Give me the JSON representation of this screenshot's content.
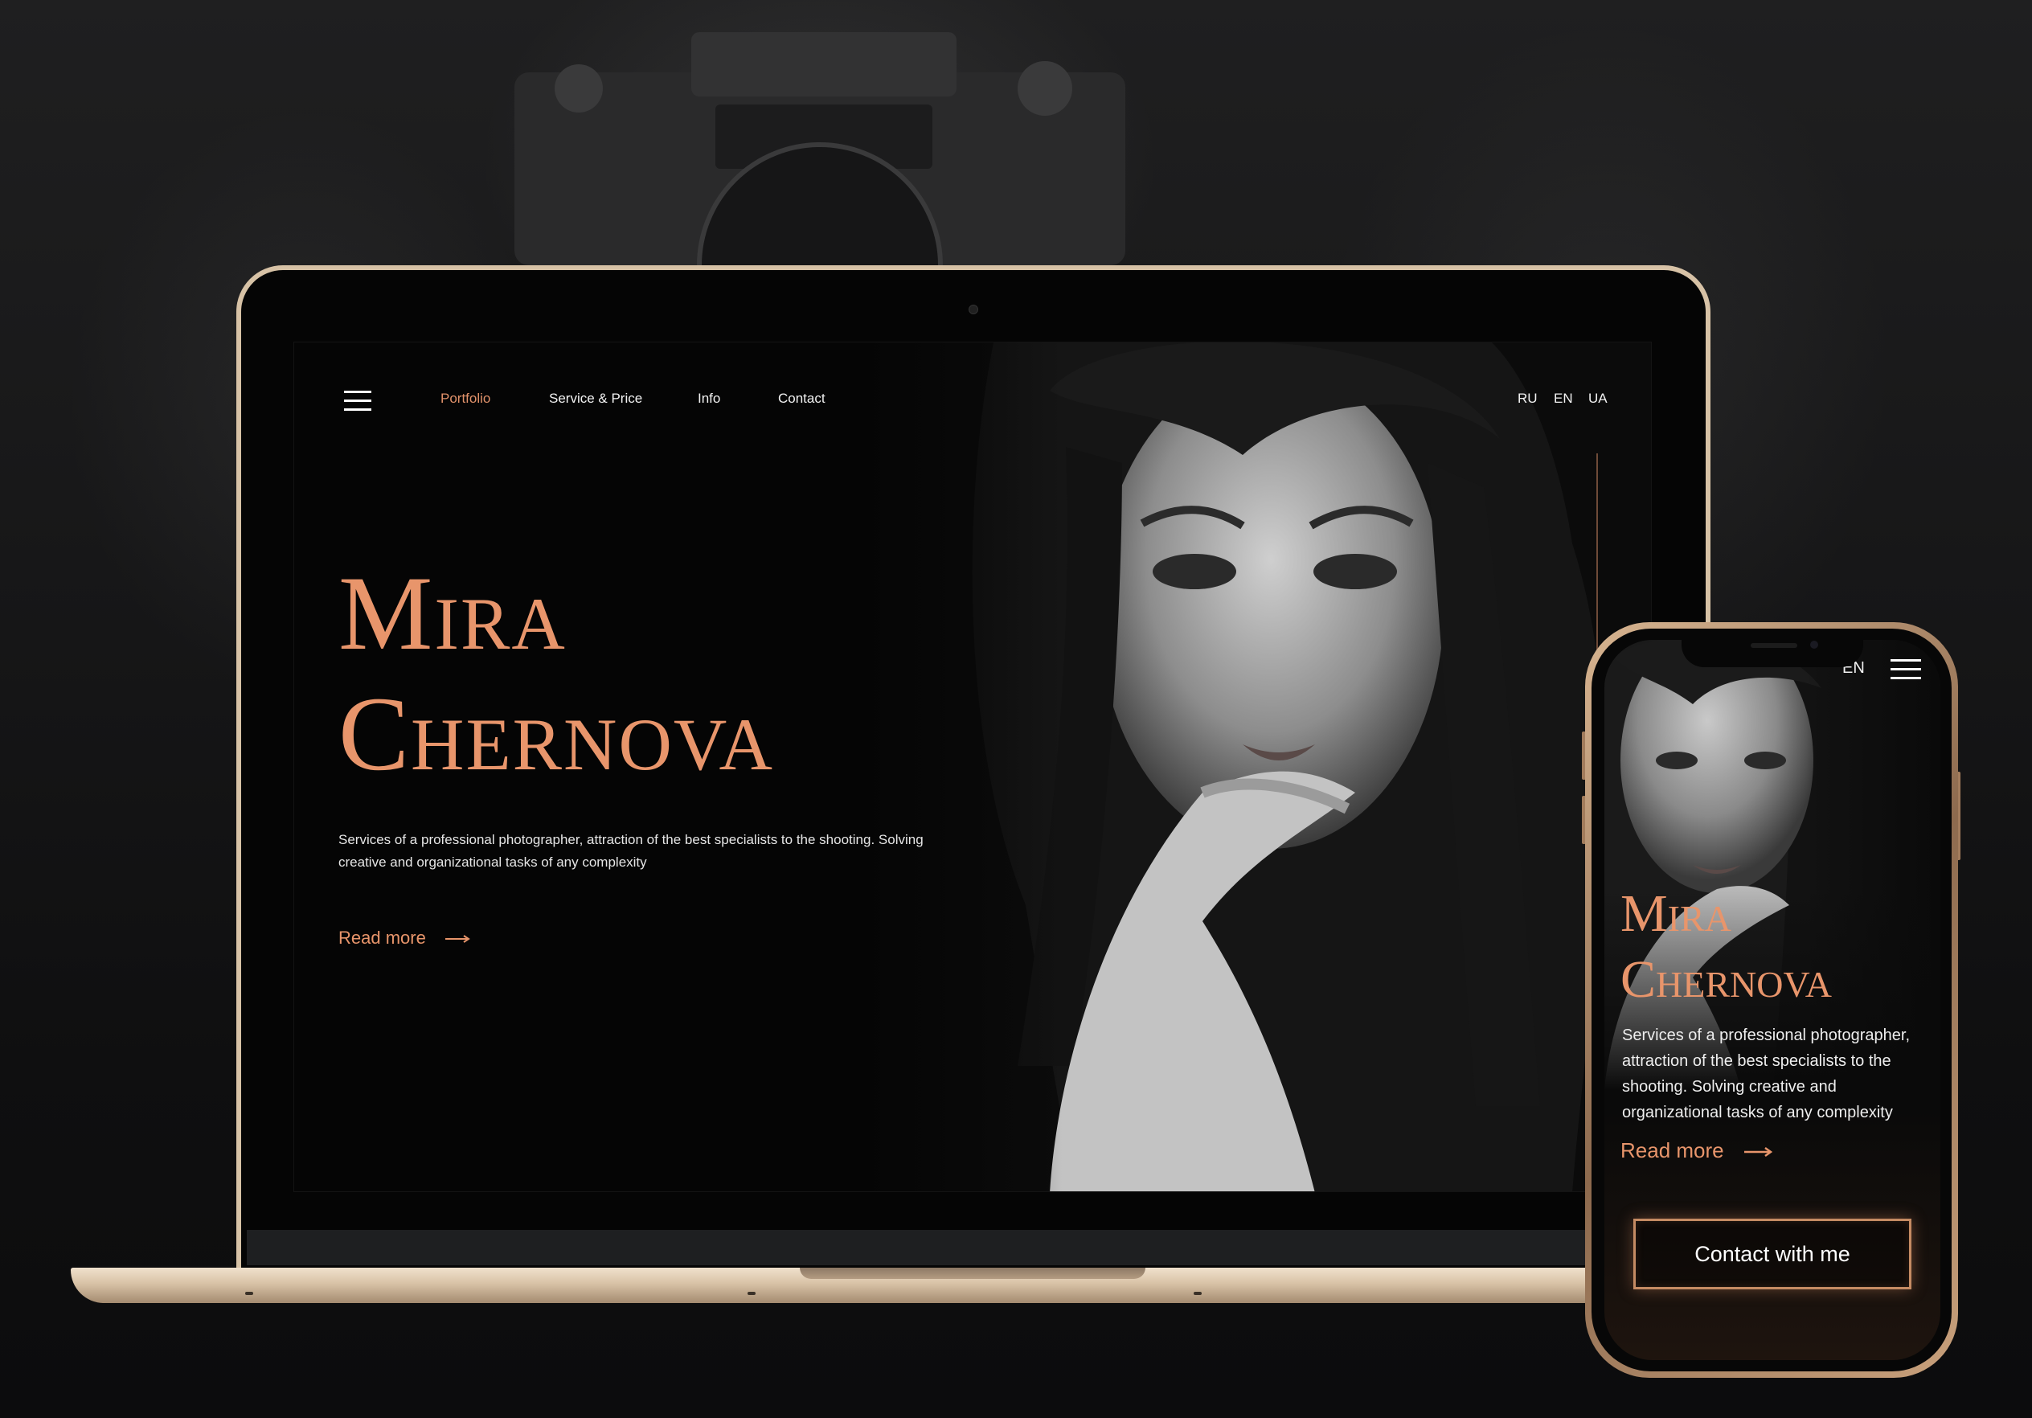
{
  "desktop": {
    "nav": {
      "items": [
        "Portfolio",
        "Service & Price",
        "Info",
        "Contact"
      ],
      "active": "Portfolio",
      "languages": [
        "RU",
        "EN",
        "UA"
      ],
      "active_language": "EN"
    },
    "hero": {
      "title_line1": "Mira",
      "title_line2": "Chernova",
      "description": "Services of a professional photographer, attraction of the best specialists to the shooting. Solving creative and organizational tasks of any complexity",
      "read_more": "Read more"
    }
  },
  "mobile": {
    "language": "EN",
    "hero": {
      "title_line1": "Mira",
      "title_line2": "Chernova",
      "description": "Services of a professional photographer, attraction of the best specialists to the shooting. Solving creative and organizational tasks of any complexity",
      "read_more": "Read more",
      "contact_button": "Contact with me"
    }
  },
  "colors": {
    "accent": "#e8956b",
    "background": "#050505",
    "device_frame": "#d7c2a6"
  },
  "icons": [
    "hamburger-menu-icon",
    "arrow-right-icon",
    "camera-icon"
  ]
}
